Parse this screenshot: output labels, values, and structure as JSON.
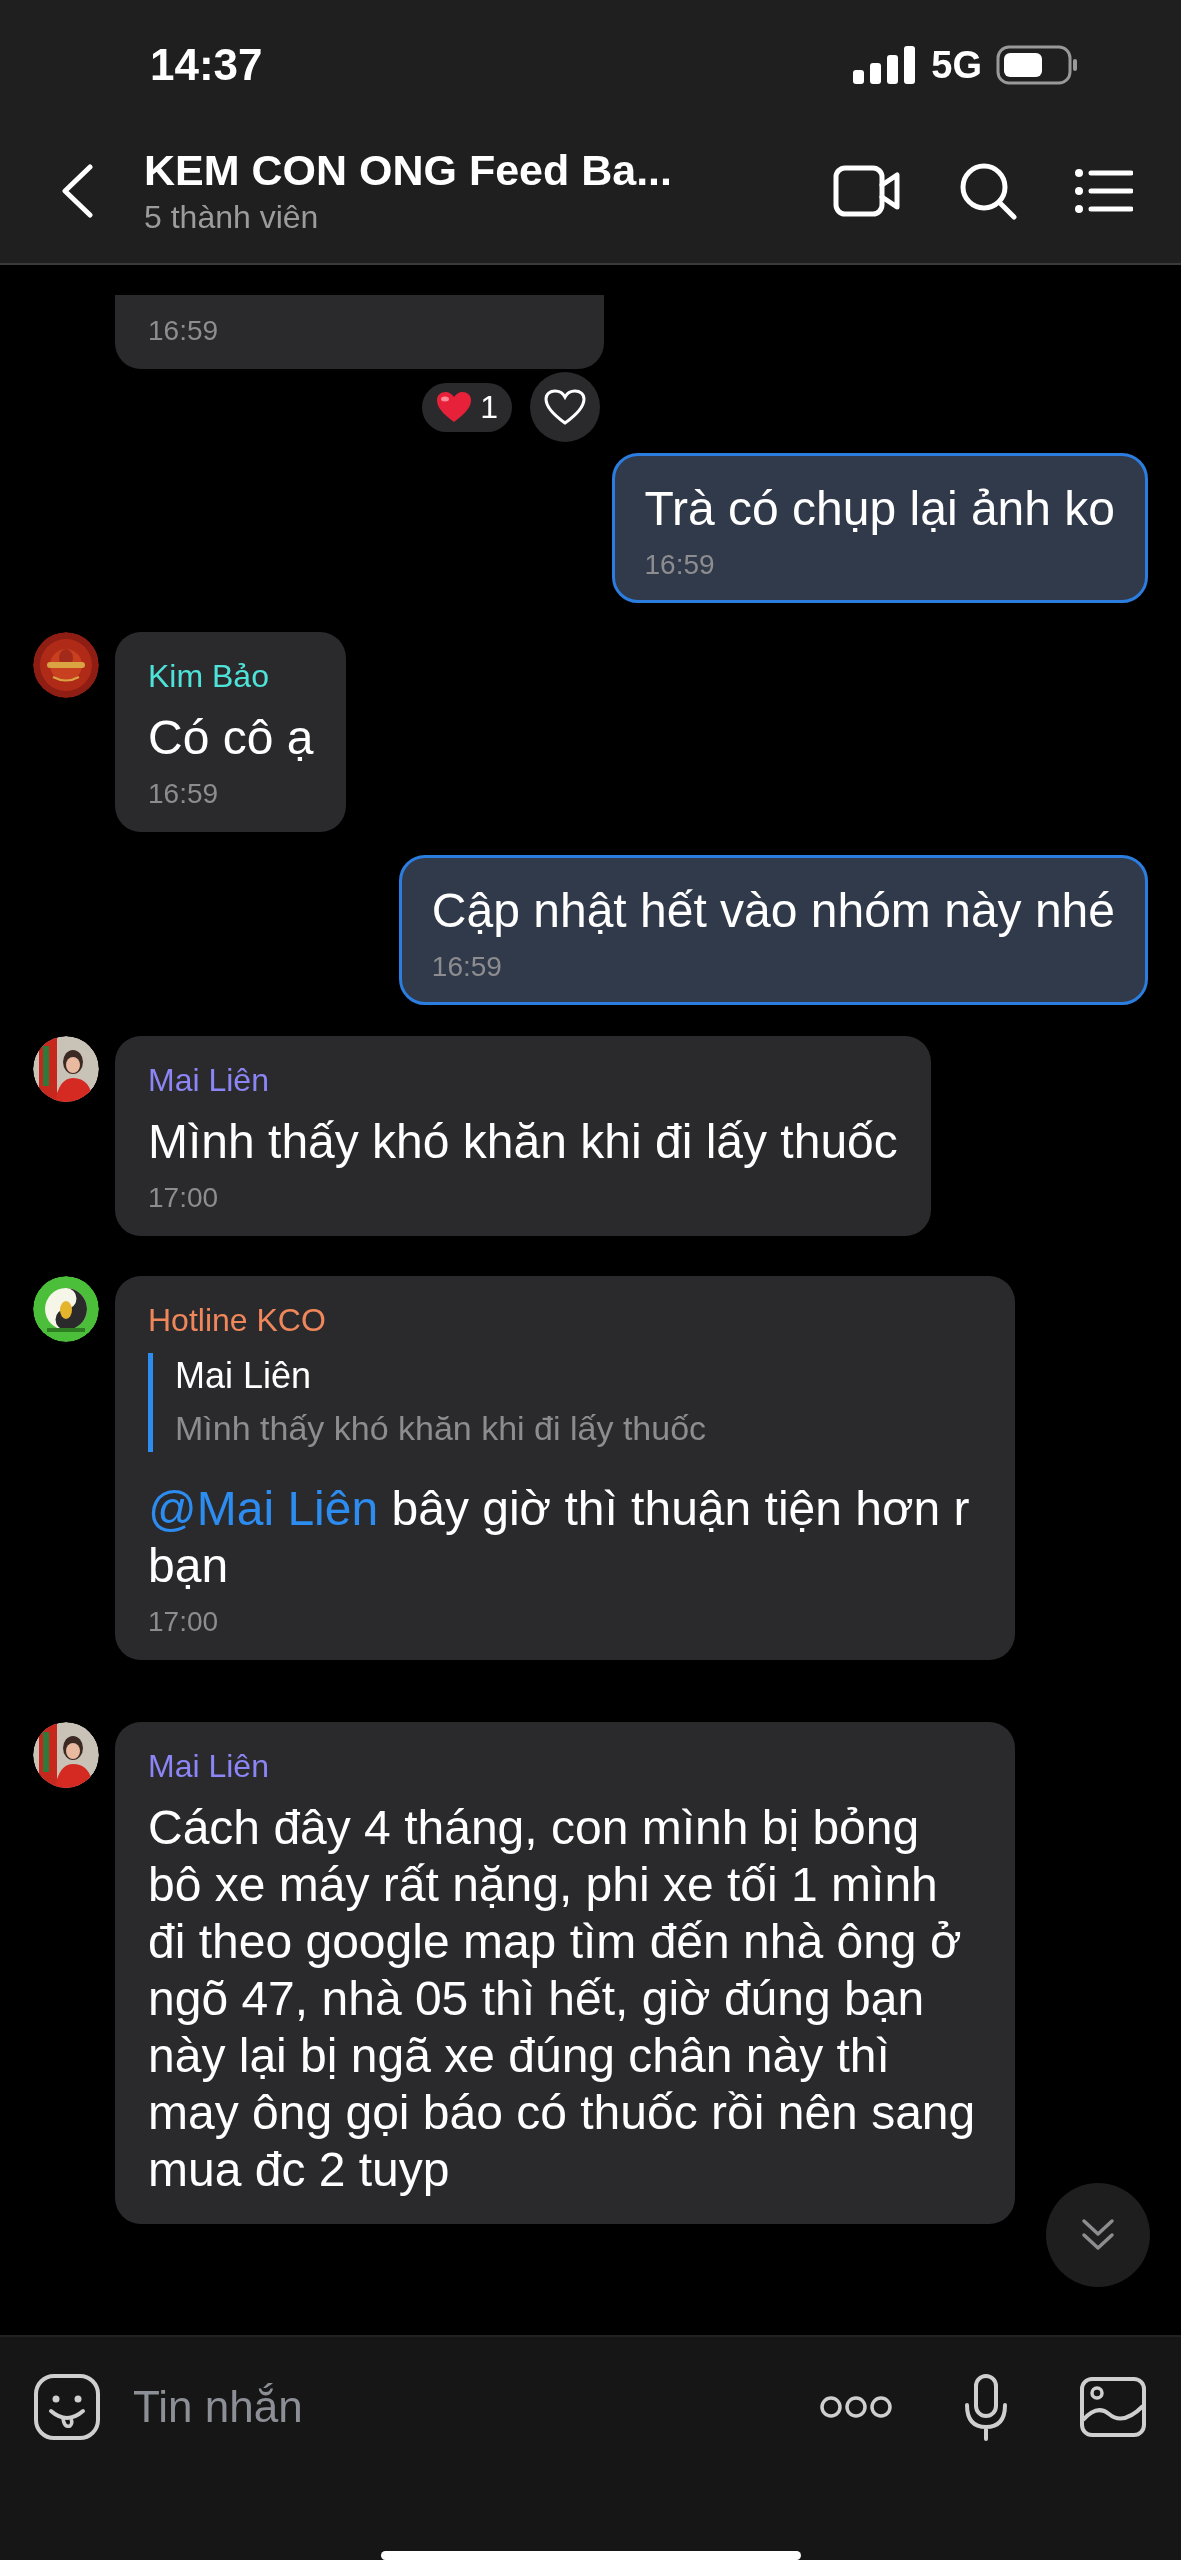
{
  "status_bar": {
    "time": "14:37",
    "network": "5G"
  },
  "header": {
    "title": "KEM CON ONG Feed Ba...",
    "subtitle": "5 thành viên"
  },
  "messages": [
    {
      "kind": "incoming",
      "time": "16:59",
      "reactions": [
        {
          "count": "1"
        }
      ]
    },
    {
      "kind": "outgoing",
      "text": "Trà có chụp lại ảnh ko",
      "time": "16:59"
    },
    {
      "kind": "incoming",
      "sender": "Kim Bảo",
      "color": "#4ee3d9",
      "text": "Có cô ạ",
      "time": "16:59"
    },
    {
      "kind": "outgoing",
      "text": "Cập nhật hết vào nhóm này nhé",
      "time": "16:59"
    },
    {
      "kind": "incoming",
      "sender": "Mai Liên",
      "color": "#8b85f5",
      "text": "Mình thấy khó khăn khi đi lấy thuốc",
      "time": "17:00"
    },
    {
      "kind": "incoming",
      "sender": "Hotline KCO",
      "color": "#f0875a",
      "reply": {
        "sender": "Mai Liên",
        "text": "Mình thấy khó khăn khi đi lấy thuốc"
      },
      "mention": "@Mai Liên",
      "text": "bây giờ thì thuận tiện hơn r bạn",
      "time": "17:00"
    },
    {
      "kind": "incoming",
      "sender": "Mai Liên",
      "color": "#8b85f5",
      "text": "Cách đây 4 tháng, con mình bị bỏng bô xe máy rất nặng, phi xe tối 1 mình đi theo google map tìm đến nhà ông ở ngõ 47, nhà 05 thì hết, giờ đúng bạn này lại bị ngã xe đúng chân này thì may ông gọi báo có thuốc rồi nên sang mua đc 2 tuyp"
    }
  ],
  "composer": {
    "placeholder": "Tin nhắn"
  }
}
